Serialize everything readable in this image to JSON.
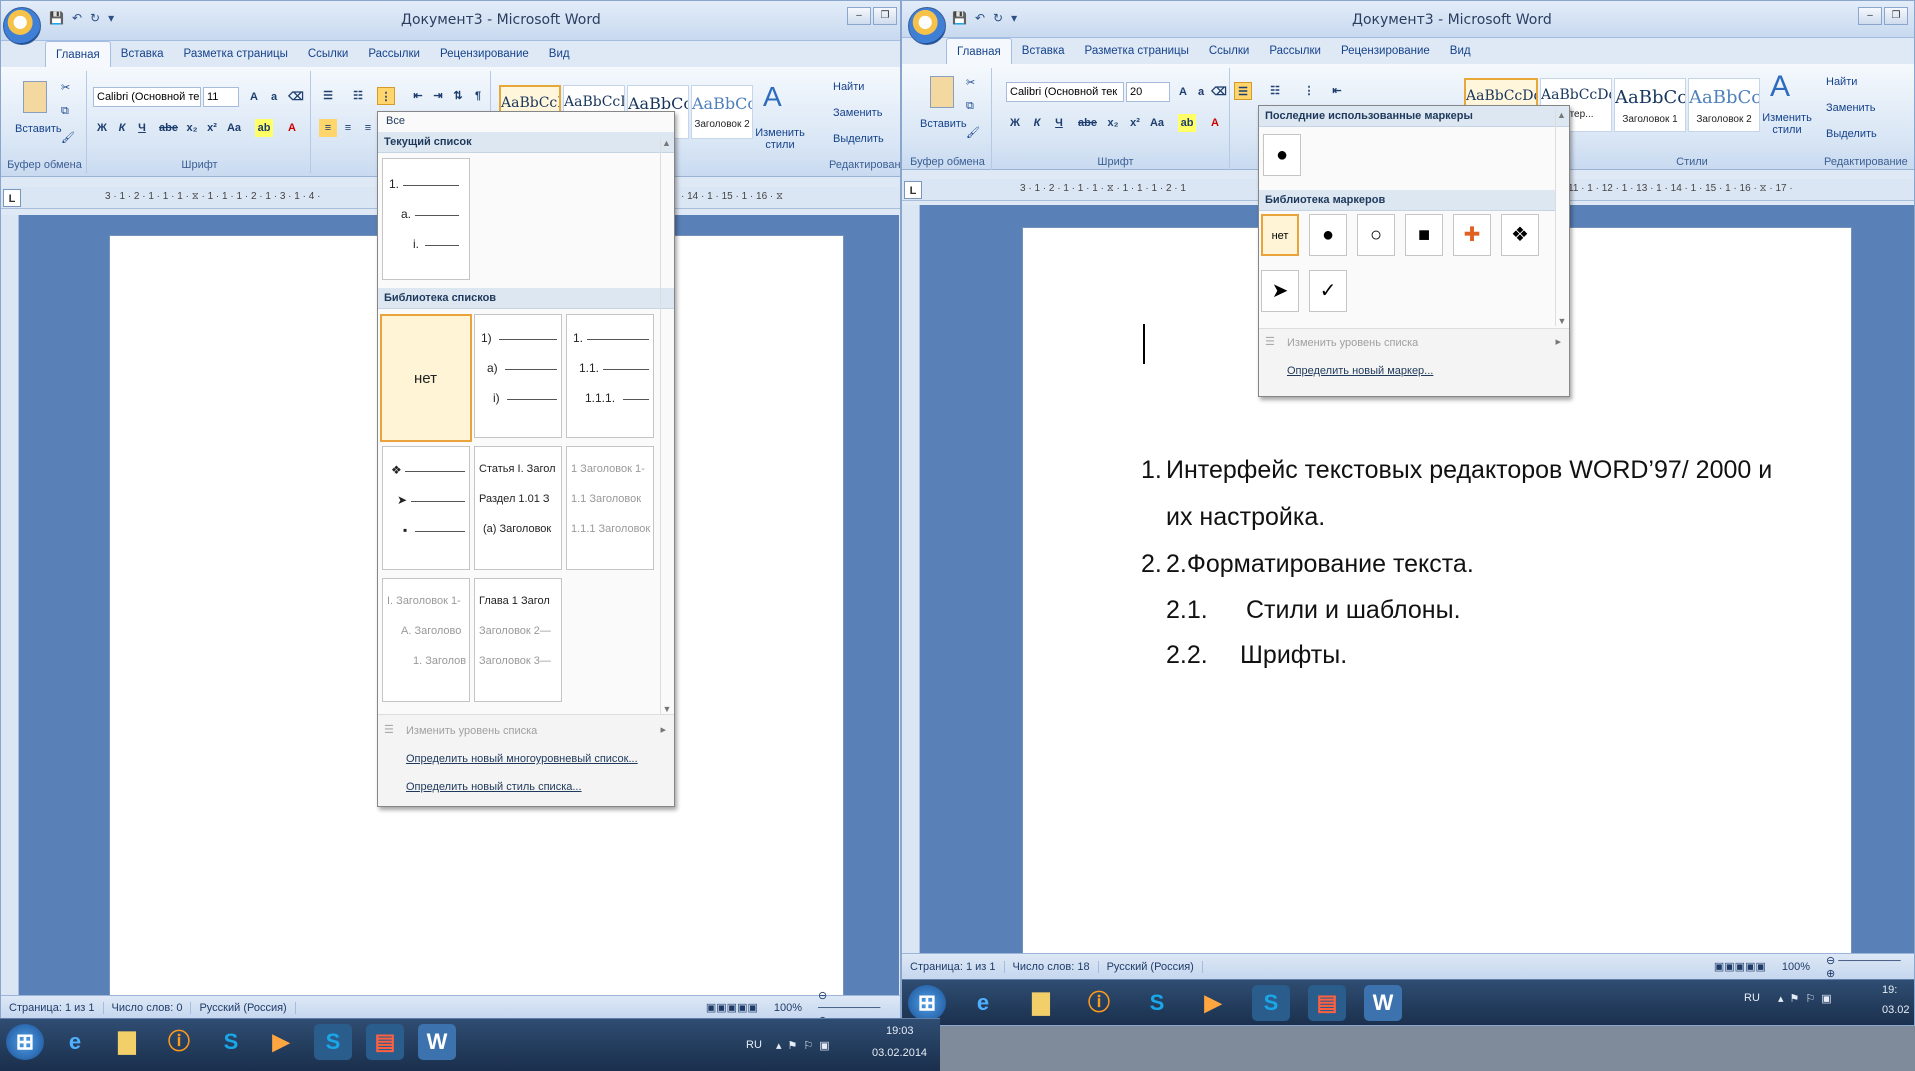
{
  "title": "Документ3 - Microsoft Word",
  "tabs": [
    "Главная",
    "Вставка",
    "Разметка страницы",
    "Ссылки",
    "Рассылки",
    "Рецензирование",
    "Вид"
  ],
  "ribbon": {
    "paste": "Вставить",
    "clipboard_group": "Буфер обмена",
    "font_group": "Шрифт",
    "styles_group": "Стили",
    "editing_group": "Редактирование",
    "change_styles": "Изменить стили",
    "find": "Найти",
    "replace": "Заменить",
    "select": "Выделить",
    "font_name": "Calibri (Основной тек",
    "font_size_left": "11",
    "font_size_right": "20",
    "styles_left": [
      {
        "preview": "AaBbCcDd",
        "caption": ""
      },
      {
        "preview": "AaBbCcDd",
        "caption": ""
      },
      {
        "preview": "AaBbCc",
        "caption": "к 1"
      },
      {
        "preview": "AaBbCc",
        "caption": "Заголовок 2"
      }
    ],
    "styles_right": [
      {
        "preview": "AaBbCcDd",
        "caption": ""
      },
      {
        "preview": "AaBbCcDd",
        "caption": "интер..."
      },
      {
        "preview": "AaBbCc",
        "caption": "Заголовок 1"
      },
      {
        "preview": "AaBbCc",
        "caption": "Заголовок 2"
      }
    ]
  },
  "multilevel_dropdown": {
    "filter": "Все",
    "current_header": "Текущий список",
    "library_header": "Библиотека списков",
    "none_label": "нет",
    "current_cell": [
      "1.",
      "a.",
      "i."
    ],
    "cell_b": [
      "1)",
      "a)",
      "i)"
    ],
    "cell_c": [
      "1.",
      "1.1.",
      "1.1.1."
    ],
    "cell_e": [
      "Статья I. Загол",
      "Раздел 1.01 З",
      "(a) Заголовок"
    ],
    "cell_f": [
      "1 Заголовок 1-",
      "1.1 Заголовок",
      "1.1.1 Заголовок"
    ],
    "cell_g": [
      "I. Заголовок 1-",
      "A. Заголово",
      "1. Заголов"
    ],
    "cell_h": [
      "Глава 1 Загол",
      "Заголовок 2—",
      "Заголовок 3—"
    ],
    "change_level": "Изменить уровень списка",
    "define_multilevel": "Определить новый многоуровневый список...",
    "define_style": "Определить новый стиль списка..."
  },
  "bullet_dropdown": {
    "recent_header": "Последние использованные маркеры",
    "library_header": "Библиотека маркеров",
    "none_label": "нет",
    "bullets": [
      "●",
      "○",
      "■",
      "✚",
      "❖",
      "➤",
      "✓"
    ],
    "change_level": "Изменить уровень списка",
    "define_new": "Определить новый маркер..."
  },
  "document": {
    "items": [
      {
        "num": "1.",
        "text": "Интерфейс текстовых редакторов  WORD’97/ 2000 и"
      },
      {
        "num": "",
        "text": "их настройка."
      },
      {
        "num": "2.",
        "text": "2.Форматирование текста."
      },
      {
        "num": "2.1.",
        "text": "Стили и шаблоны."
      },
      {
        "num": "2.2.",
        "text": "Шрифты."
      }
    ]
  },
  "status_left": {
    "page": "Страница: 1 из 1",
    "words": "Число слов: 0",
    "lang": "Русский (Россия)",
    "zoom": "100%"
  },
  "status_right": {
    "page": "Страница: 1 из 1",
    "words": "Число слов: 18",
    "lang": "Русский (Россия)",
    "zoom": "100%"
  },
  "ruler_left": "3 · 1 · 2 · 1 · 1 · 1 · ⧖ · 1 · 1 · 1 · 2 · 1 · 3 · 1 · 4 ·",
  "ruler_left_end": "· 14 · 1 · 15 · 1 · 16 · ⧖",
  "ruler_right": "3 · 1 · 2 · 1 · 1 · 1 · ⧖ · 1 · 1 · 1 · 2 · 1",
  "ruler_right_end": "11 · 1 · 12 · 1 · 13 · 1 · 14 · 1 · 15 · 1 · 16 · ⧖ · 17 ·",
  "tray": {
    "lang": "RU",
    "time": "19:03",
    "date": "03.02.2014",
    "time_r": "19:",
    "date_r": "03.02"
  }
}
